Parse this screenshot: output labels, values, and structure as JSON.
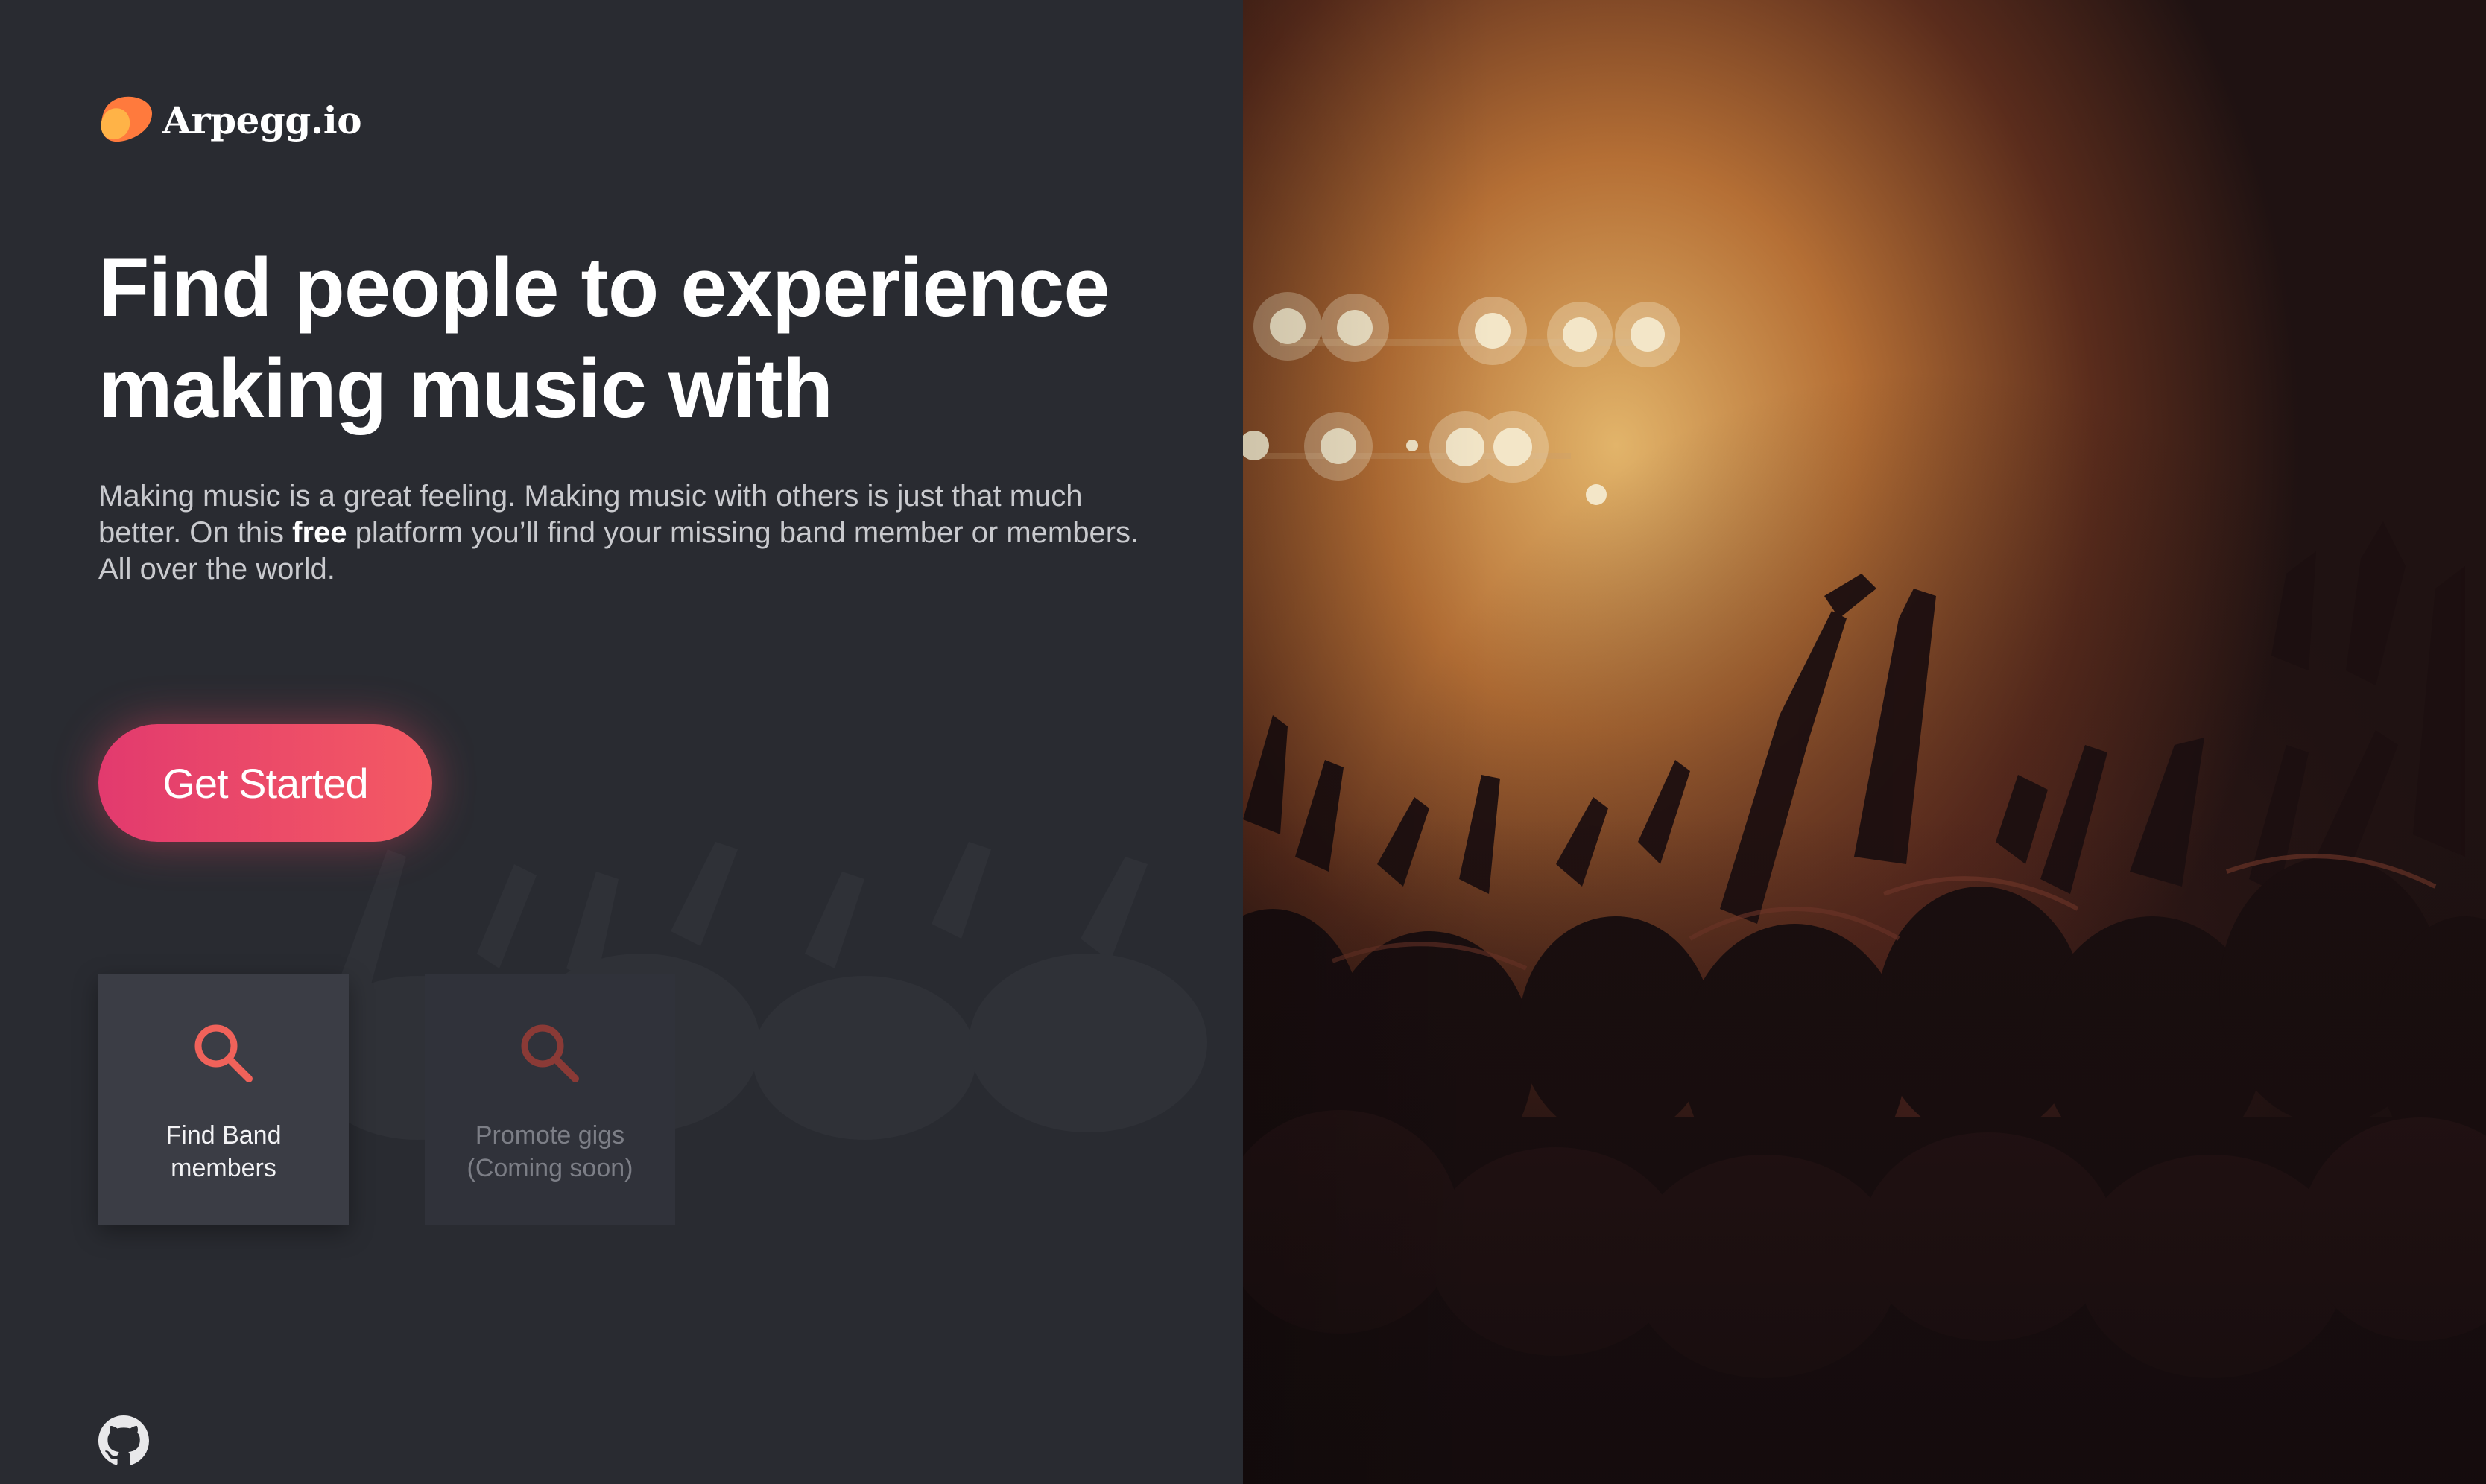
{
  "brand": {
    "name": "Arpegg.io",
    "logo_icon": "orange-blob-logo-icon"
  },
  "hero": {
    "headline_line1": "Find people to experience",
    "headline_line2": "making music with",
    "intro_before": "Making music is a great feeling. Making music with others is just that much better. On this ",
    "intro_bold": "free",
    "intro_after": " platform you’ll find your missing band member or members. All over the world."
  },
  "cta": {
    "label": "Get Started"
  },
  "features": [
    {
      "icon": "search-icon",
      "label_line1": "Find Band",
      "label_line2": "members",
      "enabled": true
    },
    {
      "icon": "search-icon",
      "label_line1": "Promote gigs",
      "label_line2": "(Coming soon)",
      "enabled": false
    }
  ],
  "footer": {
    "icon": "github-icon"
  },
  "colors": {
    "accent_start": "#e23a6e",
    "accent_end": "#f45a63",
    "icon_accent": "#f0625a",
    "panel_background": "#292b31",
    "tile_active": "#3b3d45",
    "tile_disabled": "#30323a"
  }
}
